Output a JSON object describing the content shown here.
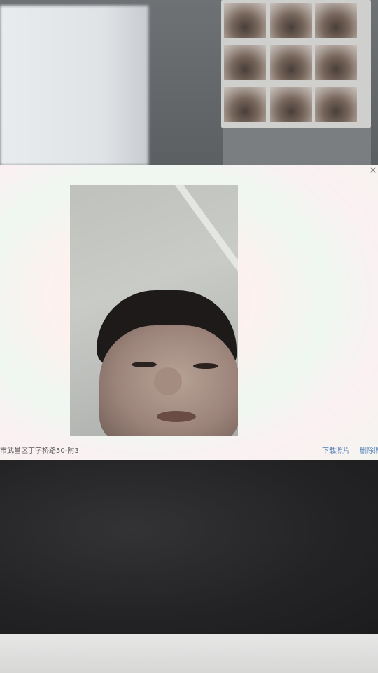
{
  "modal": {
    "close_glyph": "×",
    "address": "市武昌区丁字桥路50-附3",
    "download_label": "下载照片",
    "delete_label": "删除照"
  },
  "colors": {
    "link": "#4f7db6",
    "address_text": "#5a5a5a"
  }
}
